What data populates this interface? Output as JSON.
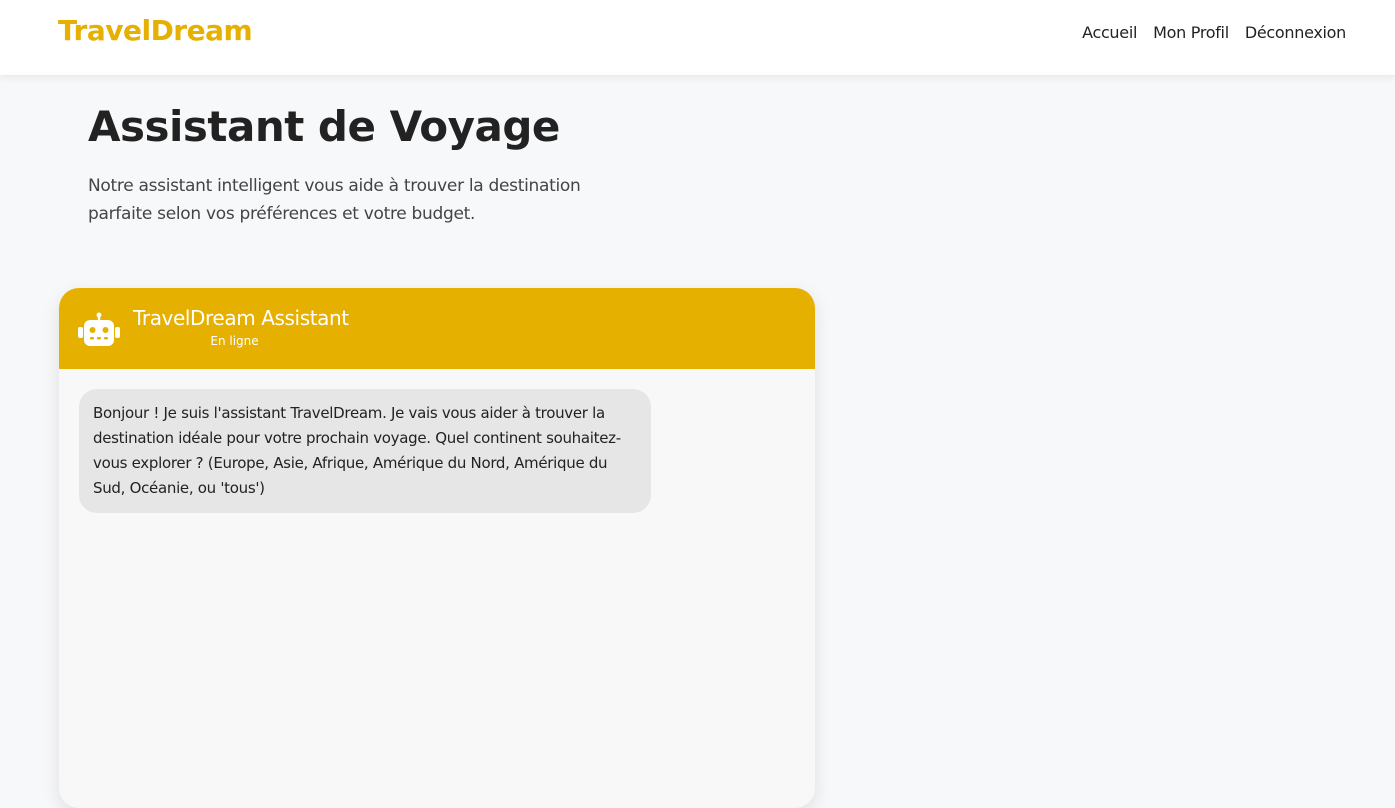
{
  "navbar": {
    "brand": "TravelDream",
    "links": [
      "Accueil",
      "Mon Profil",
      "Déconnexion"
    ]
  },
  "page": {
    "title": "Assistant de Voyage",
    "subtitle": "Notre assistant intelligent vous aide à trouver la destination parfaite selon vos préférences et votre budget."
  },
  "chat": {
    "header": {
      "icon": "robot-icon",
      "name": "TravelDream Assistant",
      "status": "En ligne"
    },
    "messages": [
      {
        "sender": "assistant",
        "text": "Bonjour ! Je suis l'assistant TravelDream. Je vais vous aider à trouver la destination idéale pour votre prochain voyage. Quel continent souhaitez-vous explorer ? (Europe, Asie, Afrique, Amérique du Nord, Amérique du Sud, Océanie, ou 'tous')"
      }
    ]
  },
  "colors": {
    "accent": "#e6b000",
    "background": "#f7f8fa",
    "bubble": "#e6e6e6"
  }
}
